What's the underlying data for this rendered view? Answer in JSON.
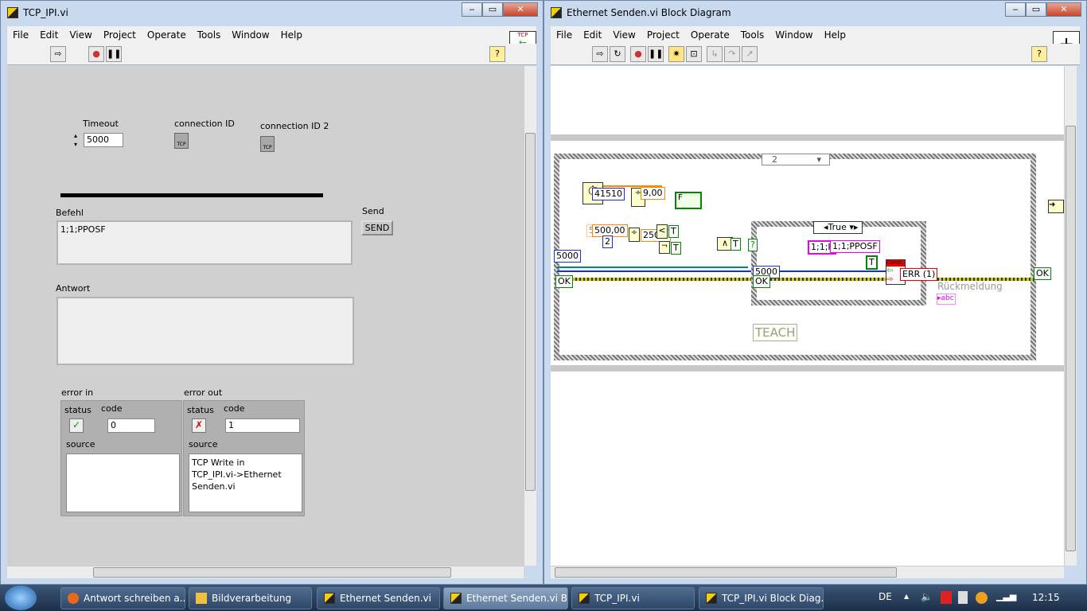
{
  "left_window": {
    "title": "TCP_IPI.vi",
    "menu": [
      "File",
      "Edit",
      "View",
      "Project",
      "Operate",
      "Tools",
      "Window",
      "Help"
    ],
    "toolbar": {
      "run": "run-arrow-icon",
      "abort": "abort-icon",
      "pause": "pause-icon",
      "help": "?"
    },
    "controls": {
      "timeout": {
        "label": "Timeout",
        "value": "5000"
      },
      "connection_id": {
        "label": "connection ID"
      },
      "connection_id_2": {
        "label": "connection ID 2"
      },
      "befehl": {
        "label": "Befehl",
        "value": "1;1;PPOSF"
      },
      "send": {
        "label": "Send",
        "button": "SEND"
      },
      "antwort": {
        "label": "Antwort",
        "value": ""
      },
      "error_in": {
        "label": "error in",
        "status_label": "status",
        "code_label": "code",
        "code": "0",
        "source_label": "source",
        "source": "",
        "status": "ok"
      },
      "error_out": {
        "label": "error out",
        "status_label": "status",
        "code_label": "code",
        "code": "1",
        "source_label": "source",
        "source": "TCP Write in TCP_IPI.vi->Ethernet Senden.vi",
        "status": "error"
      }
    }
  },
  "right_window": {
    "title": "Ethernet Senden.vi Block Diagram",
    "menu": [
      "File",
      "Edit",
      "View",
      "Project",
      "Operate",
      "Tools",
      "Window",
      "Help"
    ],
    "diagram": {
      "case_selector": "2",
      "inner_case_selector": "True",
      "const_41510": "41510",
      "const_9": "9,00",
      "const_500": "500,00",
      "const_500_back": "50",
      "const_2": "2",
      "const_250": "250,0",
      "const_5000": "5000",
      "const_5000_inner": "5000",
      "ok_left": "OK",
      "ok_inner": "OK",
      "ok_right": "OK",
      "string_const": "1;1;P",
      "string_const2": "1;1;PPOSF",
      "bool_T": "T",
      "bool_F": "F",
      "err_indicator": "ERR (1)",
      "tcp_write_header": "Comm.",
      "rueckmeldung": "Rückmeldung",
      "teach": "TEACH",
      "and": "∧",
      "less": "<",
      "not": "¬",
      "case_terminal": "?"
    }
  },
  "taskbar": {
    "items": [
      {
        "label": "Antwort schreiben a...",
        "icon": "firefox-icon"
      },
      {
        "label": "Bildverarbeitung",
        "icon": "folder-icon"
      },
      {
        "label": "Ethernet Senden.vi",
        "icon": "labview-icon"
      },
      {
        "label": "Ethernet Senden.vi Bl...",
        "icon": "labview-icon",
        "active": true
      },
      {
        "label": "TCP_IPI.vi",
        "icon": "labview-icon"
      },
      {
        "label": "TCP_IPI.vi Block Diag...",
        "icon": "labview-icon"
      }
    ],
    "language": "DE",
    "clock": "12:15"
  }
}
